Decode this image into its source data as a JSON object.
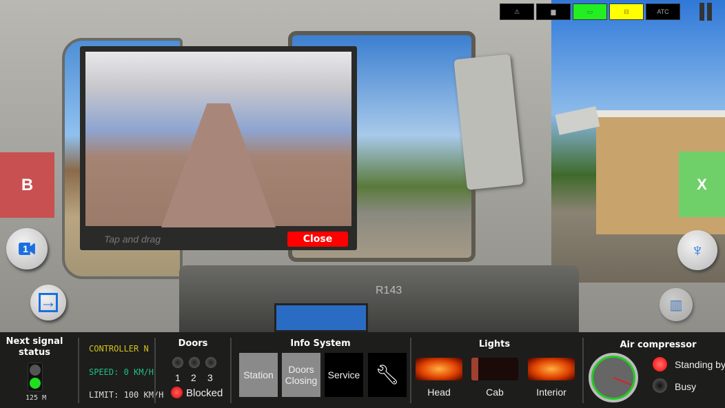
{
  "topbar": {
    "items": [
      {
        "icon": "warning-icon",
        "color": "#000000"
      },
      {
        "icon": "compressor-icon",
        "color": "#000000"
      },
      {
        "icon": "motor-icon",
        "color": "#22ee22"
      },
      {
        "icon": "battery-icon",
        "color": "#ffff00"
      },
      {
        "label": "ATC",
        "color": "#000000"
      }
    ],
    "pause_icon": "pause-icon"
  },
  "camera_popup": {
    "hint": "Tap and drag",
    "close_label": "Close"
  },
  "side_buttons": {
    "b_label": "B",
    "x_label": "X",
    "camera_number": "1"
  },
  "scene": {
    "train_label": "R143"
  },
  "panel": {
    "signal": {
      "title": "Next signal status",
      "distance": "125 M",
      "state": "green"
    },
    "controller": {
      "mode": "CONTROLLER N",
      "speed": "SPEED: 0 KM/H",
      "limit": "LIMIT: 100 KM/H",
      "colors": {
        "mode": "#d4c21a",
        "speed": "#20c080",
        "limit": "#dddddd"
      }
    },
    "doors": {
      "title": "Doors",
      "numbers": [
        "1",
        "2",
        "3"
      ],
      "status": "Blocked"
    },
    "info": {
      "title": "Info System",
      "buttons": [
        "Station",
        "Doors Closing",
        "Service"
      ],
      "tool_icon": "wrench-icon"
    },
    "lights": {
      "title": "Lights",
      "switches": [
        {
          "label": "Head",
          "on": true
        },
        {
          "label": "Cab",
          "on": false
        },
        {
          "label": "Interior",
          "on": true
        }
      ]
    },
    "air": {
      "title": "Air compressor",
      "states": [
        {
          "label": "Standing by",
          "active": true
        },
        {
          "label": "Busy",
          "active": false
        }
      ]
    }
  }
}
